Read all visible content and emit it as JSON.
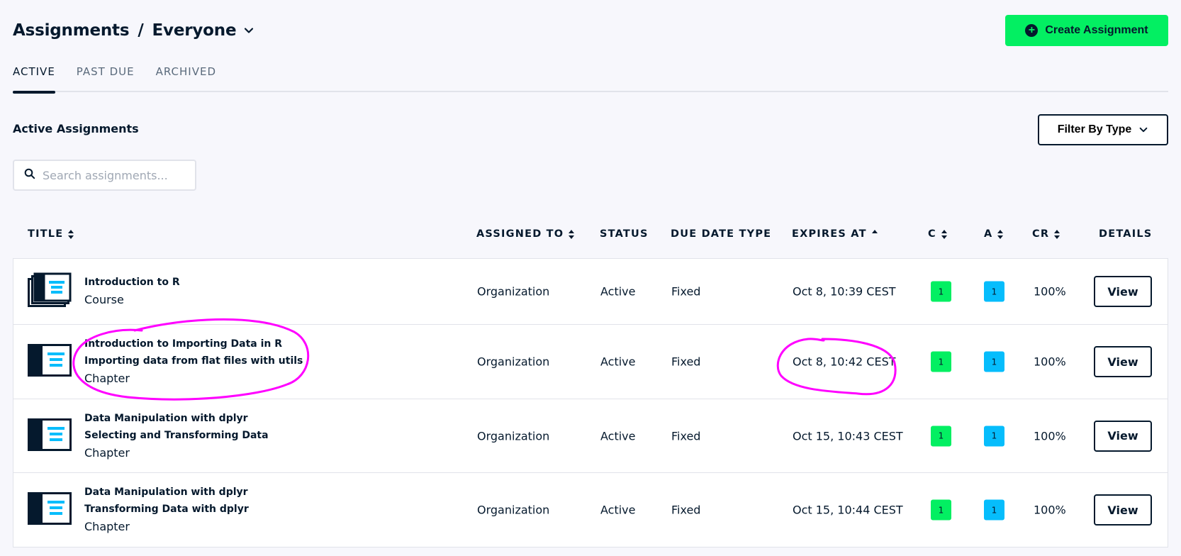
{
  "header": {
    "crumb_root": "Assignments",
    "crumb_separator": "/",
    "crumb_current": "Everyone",
    "create_label": "Create Assignment"
  },
  "tabs": [
    {
      "label": "ACTIVE",
      "active": true
    },
    {
      "label": "PAST DUE",
      "active": false
    },
    {
      "label": "ARCHIVED",
      "active": false
    }
  ],
  "section_title": "Active Assignments",
  "filter_label": "Filter By Type",
  "search": {
    "placeholder": "Search assignments..."
  },
  "columns": {
    "title": "TITLE",
    "assigned_to": "ASSIGNED TO",
    "status": "STATUS",
    "due_date_type": "DUE DATE TYPE",
    "expires_at": "EXPIRES AT",
    "c": "C",
    "a": "A",
    "cr": "CR",
    "details": "DETAILS"
  },
  "rows": [
    {
      "icon": "course-icon",
      "title_lines": [
        "Introduction to R"
      ],
      "type": "Course",
      "assigned_to": "Organization",
      "status": "Active",
      "due_date_type": "Fixed",
      "expires_at": "Oct 8, 10:39 CEST",
      "c": "1",
      "a": "1",
      "cr": "100%",
      "view": "View"
    },
    {
      "icon": "chapter-icon",
      "title_lines": [
        "Introduction to Importing Data in R",
        "Importing data from flat files with utils"
      ],
      "type": "Chapter",
      "assigned_to": "Organization",
      "status": "Active",
      "due_date_type": "Fixed",
      "expires_at": "Oct 8, 10:42 CEST",
      "c": "1",
      "a": "1",
      "cr": "100%",
      "view": "View"
    },
    {
      "icon": "chapter-icon",
      "title_lines": [
        "Data Manipulation with dplyr",
        "Selecting and Transforming Data"
      ],
      "type": "Chapter",
      "assigned_to": "Organization",
      "status": "Active",
      "due_date_type": "Fixed",
      "expires_at": "Oct 15, 10:43 CEST",
      "c": "1",
      "a": "1",
      "cr": "100%",
      "view": "View"
    },
    {
      "icon": "chapter-icon",
      "title_lines": [
        "Data Manipulation with dplyr",
        "Transforming Data with dplyr"
      ],
      "type": "Chapter",
      "assigned_to": "Organization",
      "status": "Active",
      "due_date_type": "Fixed",
      "expires_at": "Oct 15, 10:44 CEST",
      "c": "1",
      "a": "1",
      "cr": "100%",
      "view": "View"
    }
  ],
  "colors": {
    "brand_green": "#03ef62",
    "navy": "#05192d",
    "badge_blue": "#06bdfc",
    "annotation_magenta": "#ff00ff",
    "border": "#e1e3ea"
  }
}
